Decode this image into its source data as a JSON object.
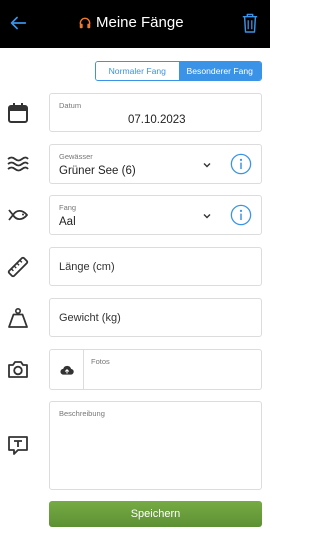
{
  "header": {
    "title": "Meine Fänge"
  },
  "toggle": {
    "normal_label": "Normaler Fang",
    "special_label": "Besonderer Fang",
    "active": "special"
  },
  "form": {
    "date": {
      "label": "Datum",
      "value": "07.10.2023"
    },
    "water": {
      "label": "Gewässer",
      "value": "Grüner See (6)"
    },
    "catch": {
      "label": "Fang",
      "value": "Aal"
    },
    "length": {
      "placeholder": "Länge (cm)"
    },
    "weight": {
      "placeholder": "Gewicht (kg)"
    },
    "photos": {
      "label": "Fotos"
    },
    "description": {
      "label": "Beschreibung"
    }
  },
  "actions": {
    "save_label": "Speichern"
  },
  "colors": {
    "header_bg": "#000000",
    "accent_blue": "#3a93e6",
    "headphone_orange": "#f07a2a",
    "save_green": "#68a03c"
  }
}
